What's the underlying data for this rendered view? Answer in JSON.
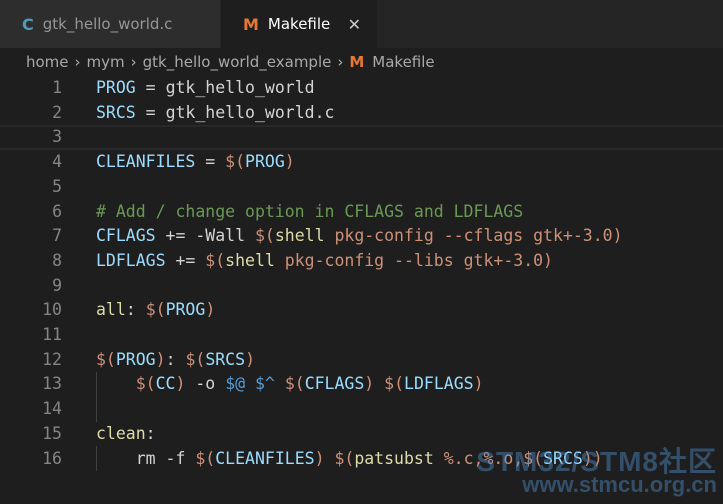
{
  "tabs": [
    {
      "icon": "C",
      "label": "gtk_hello_world.c"
    },
    {
      "icon": "M",
      "label": "Makefile",
      "close": "✕"
    }
  ],
  "breadcrumb": {
    "items": [
      "home",
      "mym",
      "gtk_hello_world_example"
    ],
    "separator": "›",
    "file_icon": "M",
    "file": "Makefile"
  },
  "editor": {
    "lines": [
      {
        "n": "1",
        "tokens": [
          {
            "t": "PROG",
            "c": "var"
          },
          {
            "t": " = ",
            "c": "op"
          },
          {
            "t": "gtk_hello_world",
            "c": "def"
          }
        ]
      },
      {
        "n": "2",
        "tokens": [
          {
            "t": "SRCS",
            "c": "var"
          },
          {
            "t": " = ",
            "c": "op"
          },
          {
            "t": "gtk_hello_world.c",
            "c": "def"
          }
        ]
      },
      {
        "n": "3",
        "tokens": []
      },
      {
        "n": "4",
        "tokens": [
          {
            "t": "CLEANFILES",
            "c": "var"
          },
          {
            "t": " = ",
            "c": "op"
          },
          {
            "t": "$(",
            "c": "str"
          },
          {
            "t": "PROG",
            "c": "var"
          },
          {
            "t": ")",
            "c": "str"
          }
        ]
      },
      {
        "n": "5",
        "tokens": []
      },
      {
        "n": "6",
        "tokens": [
          {
            "t": "# Add / change option in CFLAGS and LDFLAGS",
            "c": "cmt"
          }
        ]
      },
      {
        "n": "7",
        "tokens": [
          {
            "t": "CFLAGS",
            "c": "var"
          },
          {
            "t": " += ",
            "c": "op"
          },
          {
            "t": "-Wall ",
            "c": "def"
          },
          {
            "t": "$(",
            "c": "str"
          },
          {
            "t": "shell",
            "c": "kw"
          },
          {
            "t": " pkg-config --cflags gtk+-3.0)",
            "c": "str"
          }
        ]
      },
      {
        "n": "8",
        "tokens": [
          {
            "t": "LDFLAGS",
            "c": "var"
          },
          {
            "t": " += ",
            "c": "op"
          },
          {
            "t": "$(",
            "c": "str"
          },
          {
            "t": "shell",
            "c": "kw"
          },
          {
            "t": " pkg-config --libs gtk+-3.0)",
            "c": "str"
          }
        ]
      },
      {
        "n": "9",
        "tokens": []
      },
      {
        "n": "10",
        "tokens": [
          {
            "t": "all",
            "c": "tgt"
          },
          {
            "t": ": ",
            "c": "op"
          },
          {
            "t": "$(",
            "c": "str"
          },
          {
            "t": "PROG",
            "c": "var"
          },
          {
            "t": ")",
            "c": "str"
          }
        ]
      },
      {
        "n": "11",
        "tokens": []
      },
      {
        "n": "12",
        "tokens": [
          {
            "t": "$(",
            "c": "str"
          },
          {
            "t": "PROG",
            "c": "var"
          },
          {
            "t": ")",
            "c": "str"
          },
          {
            "t": ": ",
            "c": "op"
          },
          {
            "t": "$(",
            "c": "str"
          },
          {
            "t": "SRCS",
            "c": "var"
          },
          {
            "t": ")",
            "c": "str"
          }
        ]
      },
      {
        "n": "13",
        "tokens": [
          {
            "t": "    ",
            "c": "def"
          },
          {
            "t": "$(",
            "c": "str"
          },
          {
            "t": "CC",
            "c": "var"
          },
          {
            "t": ")",
            "c": "str"
          },
          {
            "t": " -o ",
            "c": "def"
          },
          {
            "t": "$@",
            "c": "auto"
          },
          {
            "t": " ",
            "c": "def"
          },
          {
            "t": "$^",
            "c": "auto"
          },
          {
            "t": " ",
            "c": "def"
          },
          {
            "t": "$(",
            "c": "str"
          },
          {
            "t": "CFLAGS",
            "c": "var"
          },
          {
            "t": ")",
            "c": "str"
          },
          {
            "t": " ",
            "c": "def"
          },
          {
            "t": "$(",
            "c": "str"
          },
          {
            "t": "LDFLAGS",
            "c": "var"
          },
          {
            "t": ")",
            "c": "str"
          }
        ]
      },
      {
        "n": "14",
        "tokens": []
      },
      {
        "n": "15",
        "tokens": [
          {
            "t": "clean",
            "c": "tgt"
          },
          {
            "t": ":",
            "c": "op"
          }
        ]
      },
      {
        "n": "16",
        "tokens": [
          {
            "t": "    rm -f ",
            "c": "def"
          },
          {
            "t": "$(",
            "c": "str"
          },
          {
            "t": "CLEANFILES",
            "c": "var"
          },
          {
            "t": ")",
            "c": "str"
          },
          {
            "t": " ",
            "c": "def"
          },
          {
            "t": "$(",
            "c": "str"
          },
          {
            "t": "patsubst",
            "c": "kw"
          },
          {
            "t": " %.c,%.o,",
            "c": "str"
          },
          {
            "t": "$(",
            "c": "str"
          },
          {
            "t": "SRCS",
            "c": "var"
          },
          {
            "t": "))",
            "c": "str"
          }
        ]
      }
    ]
  },
  "watermark": {
    "line1": "STM32/STM8社区",
    "line2": "www.stmcu.org.cn"
  }
}
